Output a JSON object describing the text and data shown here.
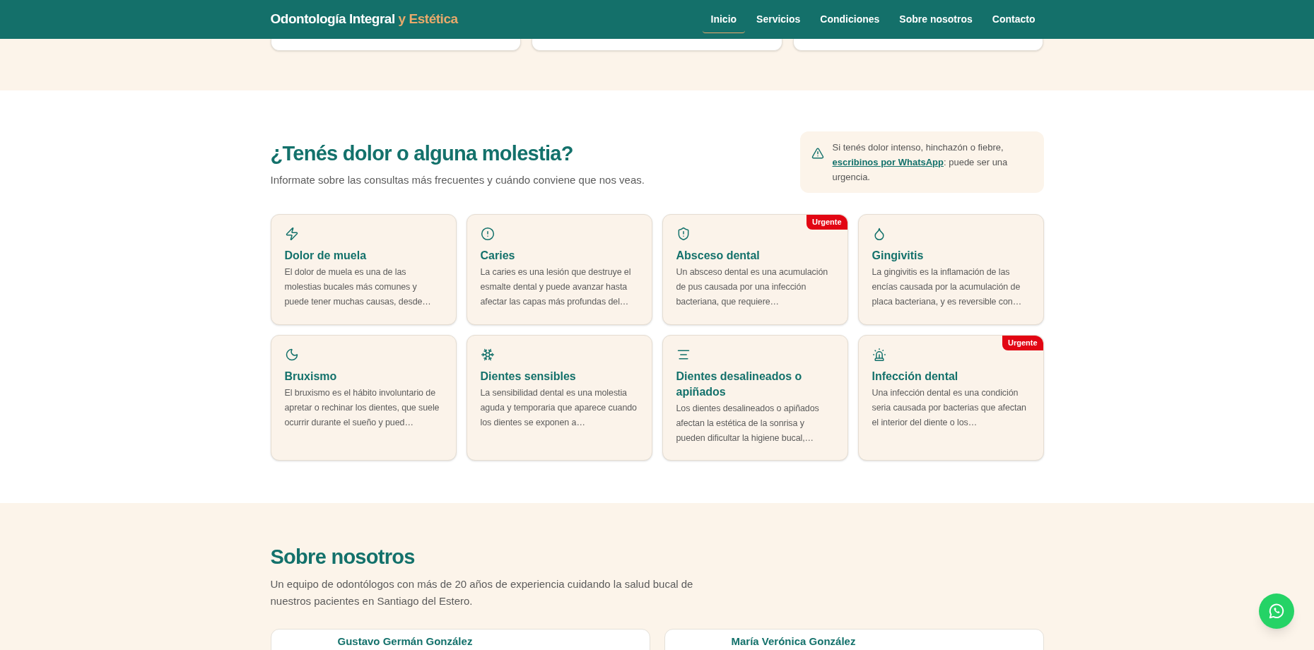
{
  "header": {
    "brand": "Odontología Integral",
    "brand_accent": "y Estética",
    "nav": [
      {
        "label": "Inicio",
        "selected": true
      },
      {
        "label": "Servicios",
        "selected": false
      },
      {
        "label": "Condiciones",
        "selected": false
      },
      {
        "label": "Sobre nosotros",
        "selected": false
      },
      {
        "label": "Contacto",
        "selected": false
      }
    ]
  },
  "conditions": {
    "title": "¿Tenés dolor o alguna molestia?",
    "subtitle": "Informate sobre las consultas más frecuentes y cuándo conviene que nos veas.",
    "alert": {
      "before": "Si tenés dolor intenso, hinchazón o fiebre, ",
      "link": "escribinos por WhatsApp",
      "after": ": puede ser una urgencia."
    },
    "cards": [
      {
        "title": "Dolor de muela",
        "text": "El dolor de muela es una de las molestias bucales más comunes y puede tener muchas causas, desde…"
      },
      {
        "title": "Caries",
        "text": "La caries es una lesión que destruye el esmalte dental y puede avanzar hasta afectar las capas más profundas del…"
      },
      {
        "title": "Absceso dental",
        "text": "Un absceso dental es una acumulación de pus causada por una infección bacteriana, que requiere…",
        "badge": "Urgente"
      },
      {
        "title": "Gingivitis",
        "text": "La gingivitis es la inflamación de las encías causada por la acumulación de placa bacteriana, y es reversible con…"
      },
      {
        "title": "Bruxismo",
        "text": "El bruxismo es el hábito involuntario de apretar o rechinar los dientes, que suele ocurrir durante el sueño y pued…"
      },
      {
        "title": "Dientes sensibles",
        "text": "La sensibilidad dental es una molestia aguda y temporaria que aparece cuando los dientes se exponen a…"
      },
      {
        "title": "Dientes desalineados o apiñados",
        "text": "Los dientes desalineados o apiñados afectan la estética de la sonrisa y pueden dificultar la higiene bucal,…"
      },
      {
        "title": "Infección dental",
        "text": "Una infección dental es una condición seria causada por bacterias que afectan el interior del diente o los…",
        "badge": "Urgente"
      }
    ]
  },
  "about": {
    "title": "Sobre nosotros",
    "subtitle": "Un equipo de odontólogos con más de 20 años de experiencia cuidando la salud bucal de nuestros pacientes en Santiago del Estero.",
    "team": [
      {
        "name": "Gustavo Germán González"
      },
      {
        "name": "María Verónica González"
      }
    ]
  }
}
